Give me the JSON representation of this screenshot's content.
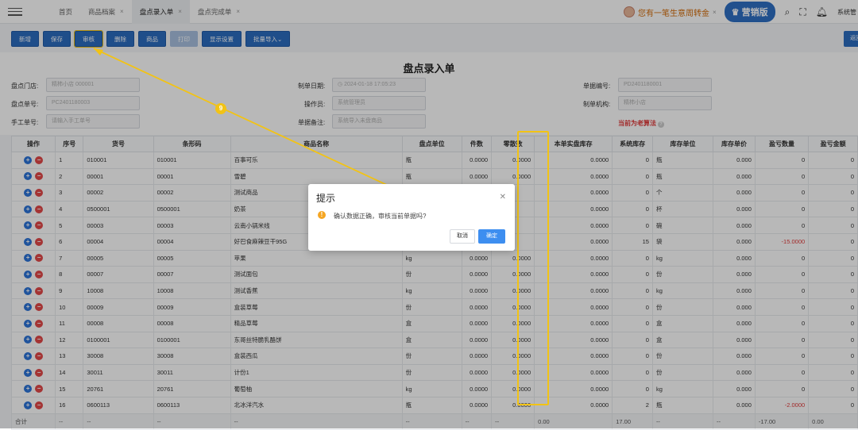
{
  "topbar": {
    "tabs": [
      {
        "label": "首页",
        "closable": false,
        "active": false
      },
      {
        "label": "商品档案",
        "closable": true,
        "active": false
      },
      {
        "label": "盘点录入单",
        "closable": true,
        "active": true
      },
      {
        "label": "盘点完成单",
        "closable": true,
        "active": false
      }
    ],
    "close_glyph": "×",
    "promo_text": "您有一笔生意周转金",
    "sales_button": "营销版",
    "user": "系统管"
  },
  "toolbar": {
    "buttons": [
      "新增",
      "保存",
      "审核",
      "删除",
      "商品",
      "打印",
      "显示设置",
      "批量导入"
    ],
    "right_button": "返回"
  },
  "form": {
    "title": "盘点录入单",
    "store_label": "盘点门店:",
    "store_value": "精柿小店 000001",
    "order_no_label": "盘点单号:",
    "order_no_value": "PC2401180003",
    "manual_no_label": "手工单号:",
    "manual_no_placeholder": "请输入手工单号",
    "date_label": "制单日期:",
    "date_value": "2024-01-18 17:05:23",
    "operator_label": "操作员:",
    "operator_value": "系统管理员",
    "remark_label": "单据备注:",
    "remark_value": "系统导入未盘商品",
    "doc_no_label": "单据编号:",
    "doc_no_value": "PD2401180001",
    "org_label": "制单机构:",
    "org_value": "精柿小店",
    "algo_text": "当前为老算法"
  },
  "table": {
    "headers": [
      "操作",
      "序号",
      "货号",
      "条形码",
      "商品名称",
      "盘点单位",
      "件数",
      "零散数",
      "本单实盘库存",
      "系统库存",
      "库存单位",
      "库存单价",
      "盈亏数量",
      "盈亏金额"
    ],
    "rows": [
      {
        "no": "1",
        "code": "010001",
        "barcode": "010001",
        "name": "百事可乐",
        "unit": "瓶",
        "qty": "0.0000",
        "loose": "0.0000",
        "actual": "0.0000",
        "sys": "0",
        "sunit": "瓶",
        "price": "0.000",
        "diff": "0",
        "amount": "0"
      },
      {
        "no": "2",
        "code": "00001",
        "barcode": "00001",
        "name": "雪碧",
        "unit": "瓶",
        "qty": "0.0000",
        "loose": "0.0000",
        "actual": "0.0000",
        "sys": "0",
        "sunit": "瓶",
        "price": "0.000",
        "diff": "0",
        "amount": "0"
      },
      {
        "no": "3",
        "code": "00002",
        "barcode": "00002",
        "name": "测试商品",
        "unit": "",
        "qty": "",
        "loose": "",
        "actual": "0.0000",
        "sys": "0",
        "sunit": "个",
        "price": "0.000",
        "diff": "0",
        "amount": "0"
      },
      {
        "no": "4",
        "code": "0500001",
        "barcode": "0500001",
        "name": "奶茶",
        "unit": "",
        "qty": "",
        "loose": "",
        "actual": "0.0000",
        "sys": "0",
        "sunit": "杯",
        "price": "0.000",
        "diff": "0",
        "amount": "0"
      },
      {
        "no": "5",
        "code": "00003",
        "barcode": "00003",
        "name": "云南小锅米线",
        "unit": "",
        "qty": "",
        "loose": "",
        "actual": "0.0000",
        "sys": "0",
        "sunit": "碗",
        "price": "0.000",
        "diff": "0",
        "amount": "0"
      },
      {
        "no": "6",
        "code": "00004",
        "barcode": "00004",
        "name": "好巴食麻辣豆干95G",
        "unit": "",
        "qty": "",
        "loose": "",
        "actual": "0.0000",
        "sys": "15",
        "sunit": "袋",
        "price": "0.000",
        "diff": "-15.0000",
        "amount": "0",
        "neg": true
      },
      {
        "no": "7",
        "code": "00005",
        "barcode": "00005",
        "name": "苹果",
        "unit": "kg",
        "qty": "0.0000",
        "loose": "0.0000",
        "actual": "0.0000",
        "sys": "0",
        "sunit": "kg",
        "price": "0.000",
        "diff": "0",
        "amount": "0"
      },
      {
        "no": "8",
        "code": "00007",
        "barcode": "00007",
        "name": "测试面包",
        "unit": "份",
        "qty": "0.0000",
        "loose": "0.0000",
        "actual": "0.0000",
        "sys": "0",
        "sunit": "份",
        "price": "0.000",
        "diff": "0",
        "amount": "0"
      },
      {
        "no": "9",
        "code": "10008",
        "barcode": "10008",
        "name": "测试香蕉",
        "unit": "kg",
        "qty": "0.0000",
        "loose": "0.0000",
        "actual": "0.0000",
        "sys": "0",
        "sunit": "kg",
        "price": "0.000",
        "diff": "0",
        "amount": "0"
      },
      {
        "no": "10",
        "code": "00009",
        "barcode": "00009",
        "name": "盒装草莓",
        "unit": "份",
        "qty": "0.0000",
        "loose": "0.0000",
        "actual": "0.0000",
        "sys": "0",
        "sunit": "份",
        "price": "0.000",
        "diff": "0",
        "amount": "0"
      },
      {
        "no": "11",
        "code": "00008",
        "barcode": "00008",
        "name": "精品草莓",
        "unit": "盒",
        "qty": "0.0000",
        "loose": "0.0000",
        "actual": "0.0000",
        "sys": "0",
        "sunit": "盒",
        "price": "0.000",
        "diff": "0",
        "amount": "0"
      },
      {
        "no": "12",
        "code": "0100001",
        "barcode": "0100001",
        "name": "东哥丝特脆乳酪饼",
        "unit": "盒",
        "qty": "0.0000",
        "loose": "0.0000",
        "actual": "0.0000",
        "sys": "0",
        "sunit": "盒",
        "price": "0.000",
        "diff": "0",
        "amount": "0"
      },
      {
        "no": "13",
        "code": "30008",
        "barcode": "30008",
        "name": "盒装西瓜",
        "unit": "份",
        "qty": "0.0000",
        "loose": "0.0000",
        "actual": "0.0000",
        "sys": "0",
        "sunit": "份",
        "price": "0.000",
        "diff": "0",
        "amount": "0"
      },
      {
        "no": "14",
        "code": "30011",
        "barcode": "30011",
        "name": "计份1",
        "unit": "份",
        "qty": "0.0000",
        "loose": "0.0000",
        "actual": "0.0000",
        "sys": "0",
        "sunit": "份",
        "price": "0.000",
        "diff": "0",
        "amount": "0"
      },
      {
        "no": "15",
        "code": "20761",
        "barcode": "20761",
        "name": "葡萄柚",
        "unit": "kg",
        "qty": "0.0000",
        "loose": "0.0000",
        "actual": "0.0000",
        "sys": "0",
        "sunit": "kg",
        "price": "0.000",
        "diff": "0",
        "amount": "0"
      },
      {
        "no": "16",
        "code": "0600113",
        "barcode": "0600113",
        "name": "北冰洋汽水",
        "unit": "瓶",
        "qty": "0.0000",
        "loose": "0.0000",
        "actual": "0.0000",
        "sys": "2",
        "sunit": "瓶",
        "price": "0.000",
        "diff": "-2.0000",
        "amount": "0",
        "neg": true
      }
    ],
    "total": {
      "label": "合计",
      "dash": "--",
      "actual": "0.00",
      "sys": "17.00",
      "diff": "-17.00",
      "amount": "0.00"
    }
  },
  "modal": {
    "title": "提示",
    "message": "确认数据正确，审核当前单据吗?",
    "cancel": "取消",
    "ok": "确定"
  },
  "annotation": {
    "step": "9"
  }
}
